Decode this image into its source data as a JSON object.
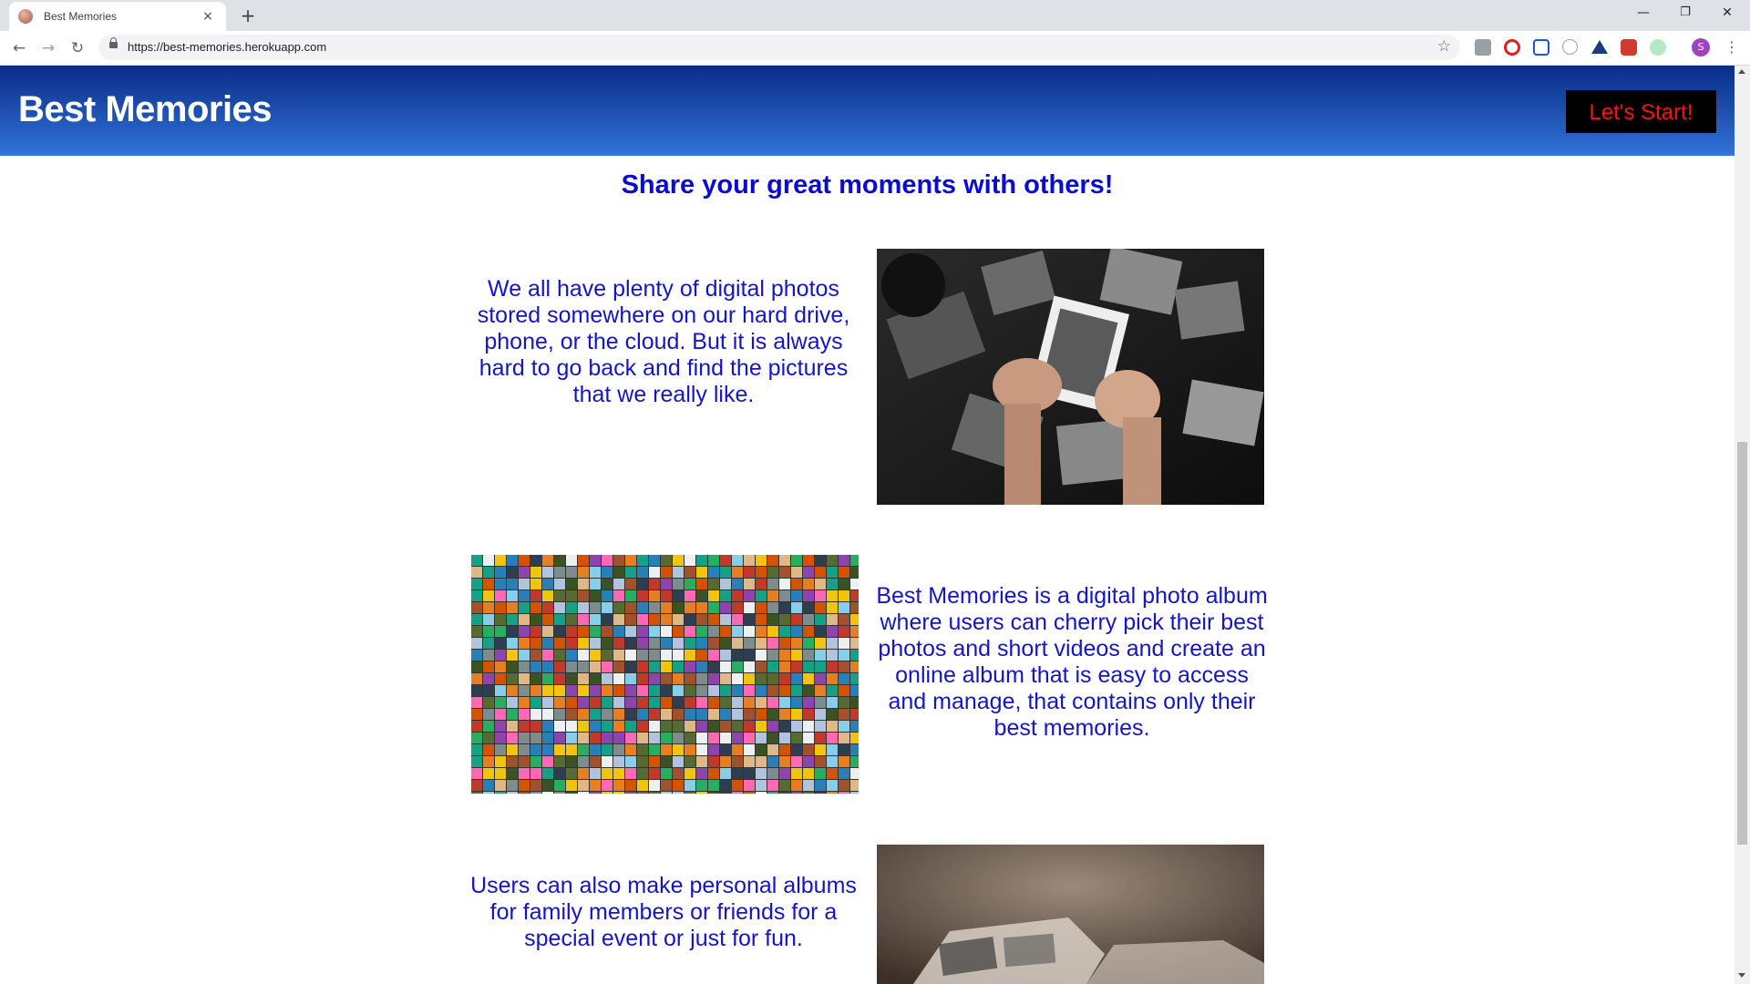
{
  "browser": {
    "tab_title": "Best Memories",
    "tab_close": "×",
    "new_tab": "+",
    "url_host": "https://best-memories.herokuapp.com",
    "window_controls": {
      "minimize": "—",
      "restore": "❐",
      "close": "✕"
    },
    "profile_initial": "S"
  },
  "header": {
    "brand": "Best Memories",
    "cta_label": "Let's Start!",
    "colors": {
      "top": "#0a2c88",
      "bottom": "#3a78dc",
      "cta_text": "#ff1111"
    }
  },
  "main": {
    "headline": "Share your great moments with others!",
    "sections": [
      {
        "text": "We all have plenty of digital photos stored somewhere on our hard drive, phone, or the cloud. But it is always hard to go back and find the pictures that we really like."
      },
      {
        "text": "Best Memories is a digital photo album where users can cherry pick their best photos and short videos and create an online album that is easy to access and manage, that contains only their best memories."
      },
      {
        "text": "Users can also make personal albums for family members or friends for a special event or just for fun."
      }
    ],
    "text_color": "#1515c8"
  }
}
